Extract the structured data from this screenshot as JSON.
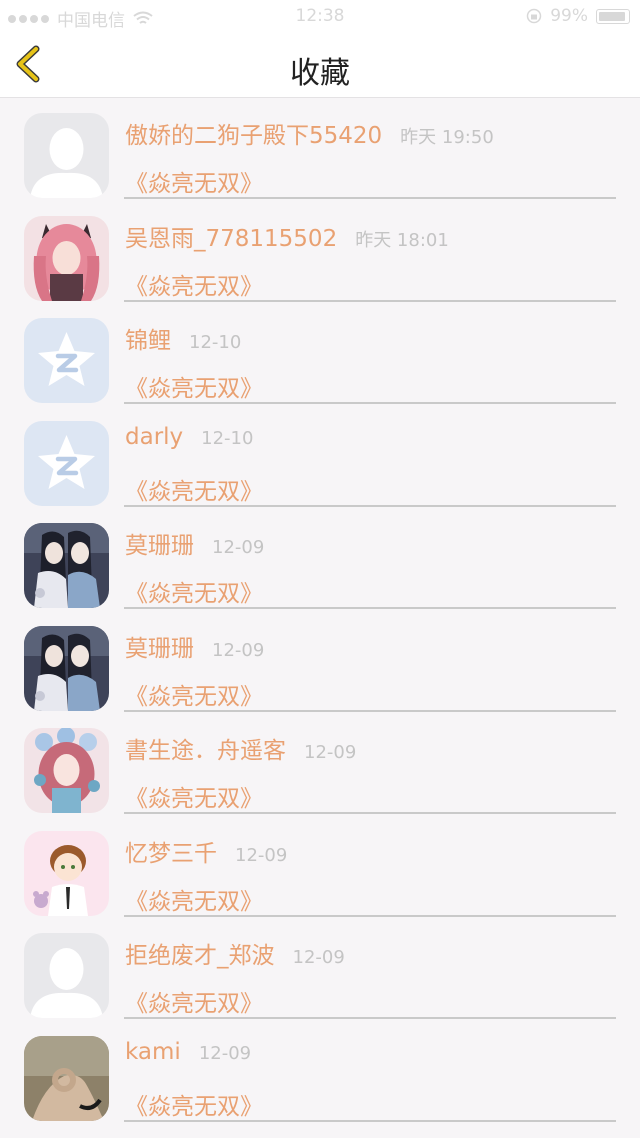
{
  "status_bar": {
    "carrier": "中国电信",
    "time": "12:38",
    "battery": "99%"
  },
  "header": {
    "title": "收藏",
    "back_icon": "chevron-left-icon",
    "accent_color": "#e6c318"
  },
  "colors": {
    "name": "#e9a172",
    "time": "#c4c4c4",
    "divider": "#c9c9c9"
  },
  "items": [
    {
      "name": "傲娇的二狗子殿下55420",
      "time": "昨天 19:50",
      "book": "《焱亮无双》",
      "avatar": "default-person-avatar"
    },
    {
      "name": "吴恩雨_778115502",
      "time": "昨天 18:01",
      "book": "《焱亮无双》",
      "avatar": "anime-girl-pink-avatar"
    },
    {
      "name": "锦鲤",
      "time": "12-10",
      "book": "《焱亮无双》",
      "avatar": "qzone-star-avatar"
    },
    {
      "name": "darly",
      "time": "12-10",
      "book": "《焱亮无双》",
      "avatar": "qzone-star-avatar"
    },
    {
      "name": "莫珊珊",
      "time": "12-09",
      "book": "《焱亮无双》",
      "avatar": "anime-couple-avatar"
    },
    {
      "name": "莫珊珊",
      "time": "12-09",
      "book": "《焱亮无双》",
      "avatar": "anime-couple-avatar"
    },
    {
      "name": "書生途．舟遥客",
      "time": "12-09",
      "book": "《焱亮无双》",
      "avatar": "anime-girl-flowers-avatar"
    },
    {
      "name": "忆梦三千",
      "time": "12-09",
      "book": "《焱亮无双》",
      "avatar": "anime-boy-avatar"
    },
    {
      "name": "拒绝废才_郑波",
      "time": "12-09",
      "book": "《焱亮无双》",
      "avatar": "default-person-avatar"
    },
    {
      "name": "kami",
      "time": "12-09",
      "book": "《焱亮无双》",
      "avatar": "hand-photo-avatar"
    }
  ]
}
